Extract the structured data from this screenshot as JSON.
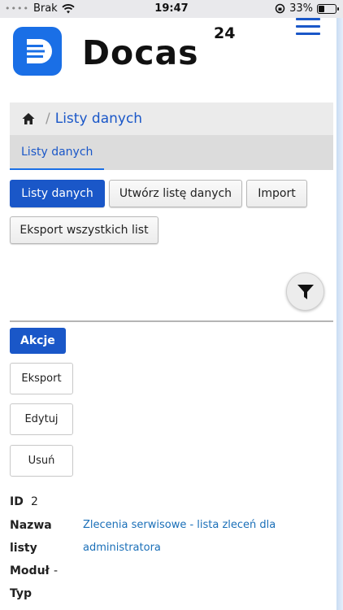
{
  "status_bar": {
    "carrier": "Brak",
    "time": "19:47",
    "battery": "33%",
    "battery_level": 0.33
  },
  "header": {
    "brand_name": "Docas",
    "brand_sup": "24"
  },
  "breadcrumb": {
    "current": "Listy danych"
  },
  "tabs": [
    {
      "label": "Listy danych",
      "active": true
    }
  ],
  "toolbar": {
    "list_label": "Listy danych",
    "create_label": "Utwórz listę danych",
    "import_label": "Import",
    "export_all_label": "Eksport wszystkich list"
  },
  "actions": {
    "menu_label": "Akcje",
    "export_label": "Eksport",
    "edit_label": "Edytuj",
    "delete_label": "Usuń"
  },
  "record": {
    "id_label": "ID",
    "id_value": "2",
    "name_label_line1": "Nazwa",
    "name_label_line2": "listy",
    "name_value_line1": "Zlecenia serwisowe - lista zleceń dla",
    "name_value_line2": "administratora",
    "module_label": "Moduł",
    "module_value": "-",
    "type_label": "Typ"
  },
  "colors": {
    "accent": "#1a57c8",
    "logo": "#1a6fe6",
    "link": "#1a6fb8"
  }
}
